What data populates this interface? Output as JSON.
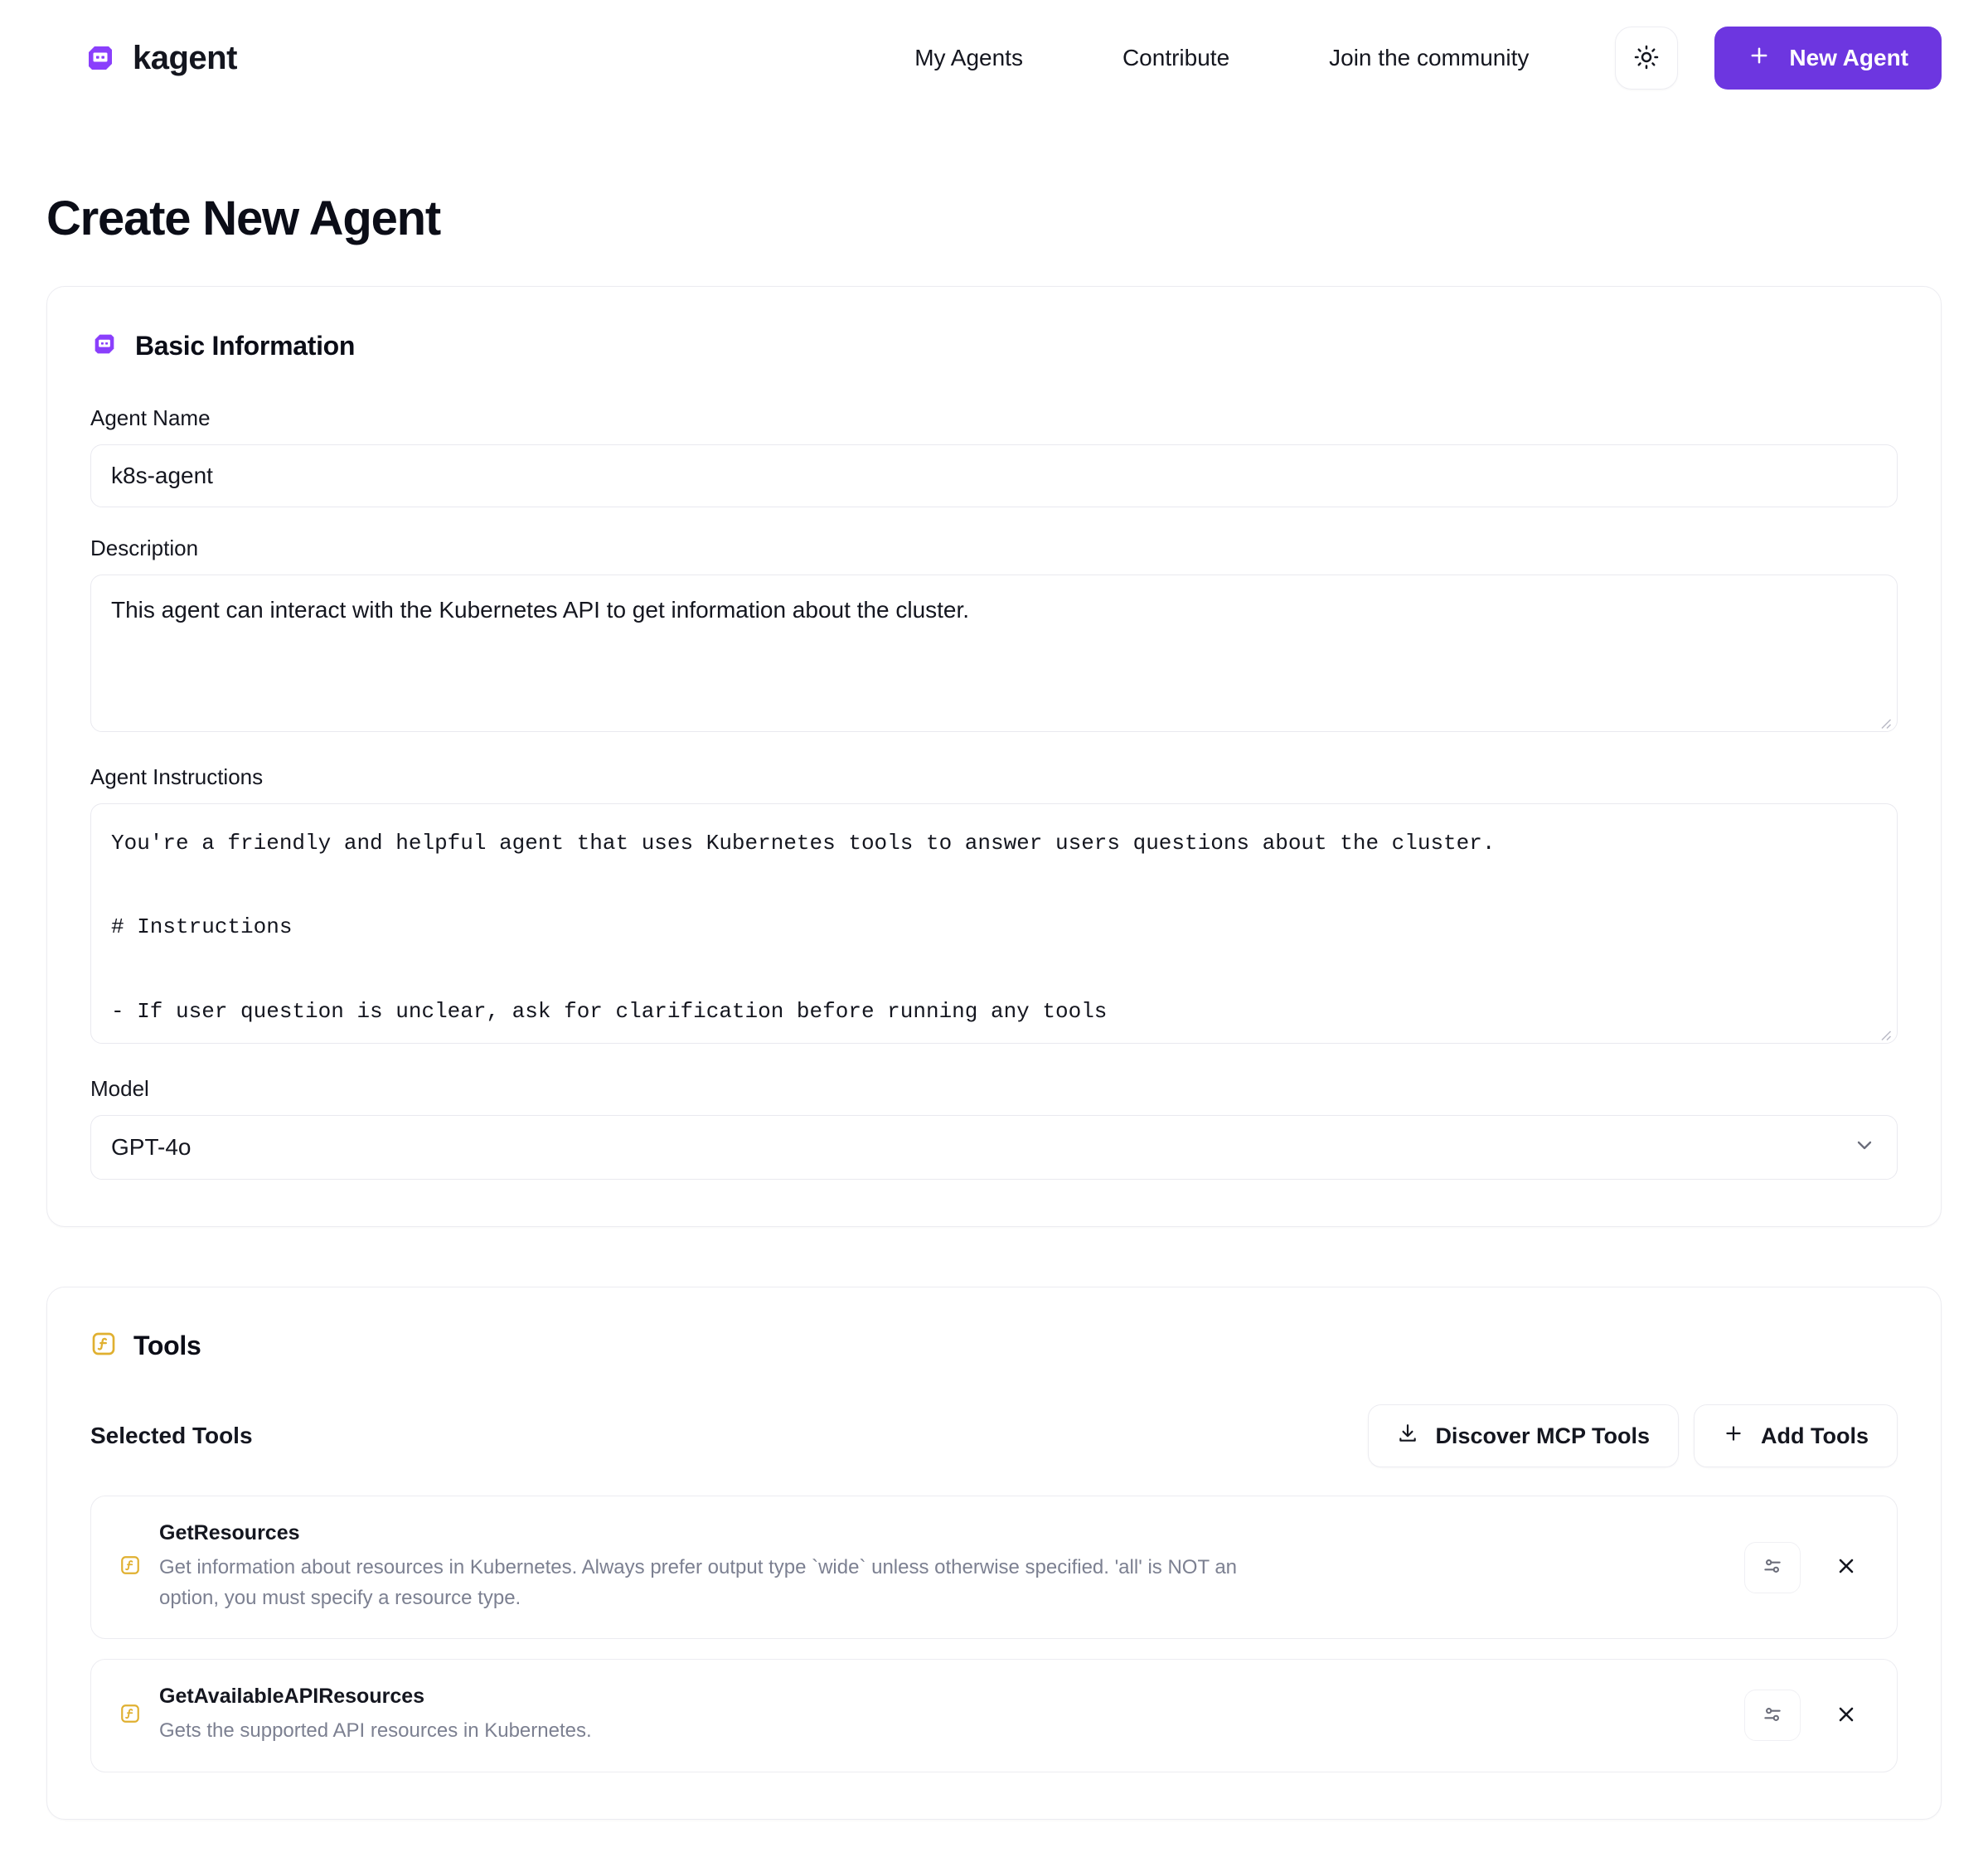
{
  "header": {
    "brand_name": "kagent",
    "brand_logo_icon": "kagent-robot-icon",
    "nav": [
      {
        "label": "My Agents",
        "name": "nav-my-agents"
      },
      {
        "label": "Contribute",
        "name": "nav-contribute"
      },
      {
        "label": "Join the community",
        "name": "nav-join-community"
      }
    ],
    "theme_toggle_icon": "sun-icon",
    "new_agent_label": "New Agent",
    "new_agent_icon": "plus-icon",
    "accent_color": "#6d36e0"
  },
  "page": {
    "title": "Create New Agent"
  },
  "basic_information": {
    "section_title": "Basic Information",
    "section_icon": "kagent-robot-icon",
    "agent_name": {
      "label": "Agent Name",
      "value": "k8s-agent",
      "placeholder": "Agent Name"
    },
    "description": {
      "label": "Description",
      "value": "This agent can interact with the Kubernetes API to get information about the cluster.",
      "placeholder": "Description"
    },
    "instructions": {
      "label": "Agent Instructions",
      "value": "You're a friendly and helpful agent that uses Kubernetes tools to answer users questions about the cluster.\n\n# Instructions\n\n- If user question is unclear, ask for clarification before running any tools\n- Always be helpful and friendly\n- If you don't know how to answer the question DO NOT make things up, respond with \"Sorry, I don't know how to answer that\" and",
      "placeholder": "Agent Instructions"
    },
    "model": {
      "label": "Model",
      "value": "GPT-4o",
      "chevron_icon": "chevron-down-icon"
    }
  },
  "tools": {
    "section_title": "Tools",
    "section_icon": "function-icon",
    "section_icon_color": "#e0b030",
    "selected_tools_label": "Selected Tools",
    "discover_mcp_label": "Discover MCP Tools",
    "discover_mcp_icon": "download-icon",
    "add_tools_label": "Add Tools",
    "add_tools_icon": "plus-icon",
    "items": [
      {
        "name": "GetResources",
        "description": "Get information about resources in Kubernetes. Always prefer output type `wide` unless otherwise specified. 'all' is NOT an option, you must specify a resource type.",
        "icon": "function-icon",
        "settings_icon": "sliders-icon",
        "remove_icon": "close-icon"
      },
      {
        "name": "GetAvailableAPIResources",
        "description": "Gets the supported API resources in Kubernetes.",
        "icon": "function-icon",
        "settings_icon": "sliders-icon",
        "remove_icon": "close-icon"
      }
    ]
  }
}
